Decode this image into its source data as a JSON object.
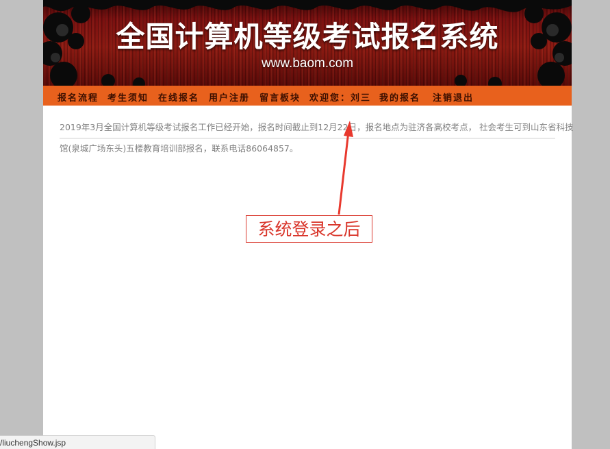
{
  "banner": {
    "title": "全国计算机等级考试报名系统",
    "url": "www.baom.com"
  },
  "nav": {
    "items": [
      {
        "label": "报名流程"
      },
      {
        "label": "考生须知"
      },
      {
        "label": "在线报名"
      },
      {
        "label": "用户注册"
      },
      {
        "label": "留言板块"
      },
      {
        "label": "欢迎您：刘三"
      },
      {
        "label": "我的报名"
      },
      {
        "label": "注销退出"
      }
    ]
  },
  "notice": {
    "line1": "2019年3月全国计算机等级考试报名工作已经开始，报名时间截止到12月22日，报名地点为驻济各高校考点， 社会考生可到山东省科技",
    "line2": "馆(泉城广场东头)五楼教育培训部报名，联系电话86064857。"
  },
  "annotation": {
    "text": "系统登录之后"
  },
  "statusbar": {
    "text": "/liuchengShow.jsp"
  },
  "colors": {
    "nav_bg": "#e8611d",
    "annotation_red": "#d9362b",
    "page_bg": "#c0c0c0"
  }
}
